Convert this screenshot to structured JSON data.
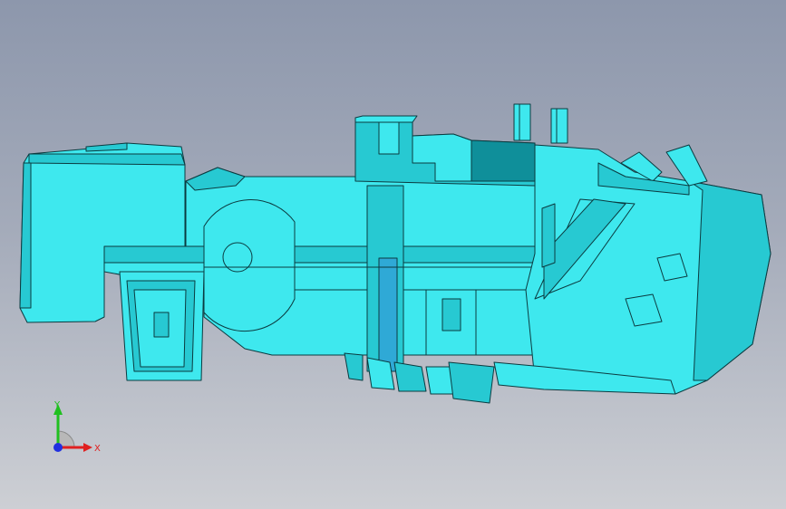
{
  "viewport": {
    "background_top": "#8d97ac",
    "background_bottom": "#cdcfd4"
  },
  "model": {
    "face_color": "#3ee8ee",
    "shade_color": "#27c9d2",
    "dark_color": "#0f8f9a",
    "edge_color": "#0b3b40"
  },
  "triad": {
    "x_label": "X",
    "y_label": "Y",
    "x_color": "#e02020",
    "y_color": "#20c020",
    "z_color": "#2030e0"
  }
}
